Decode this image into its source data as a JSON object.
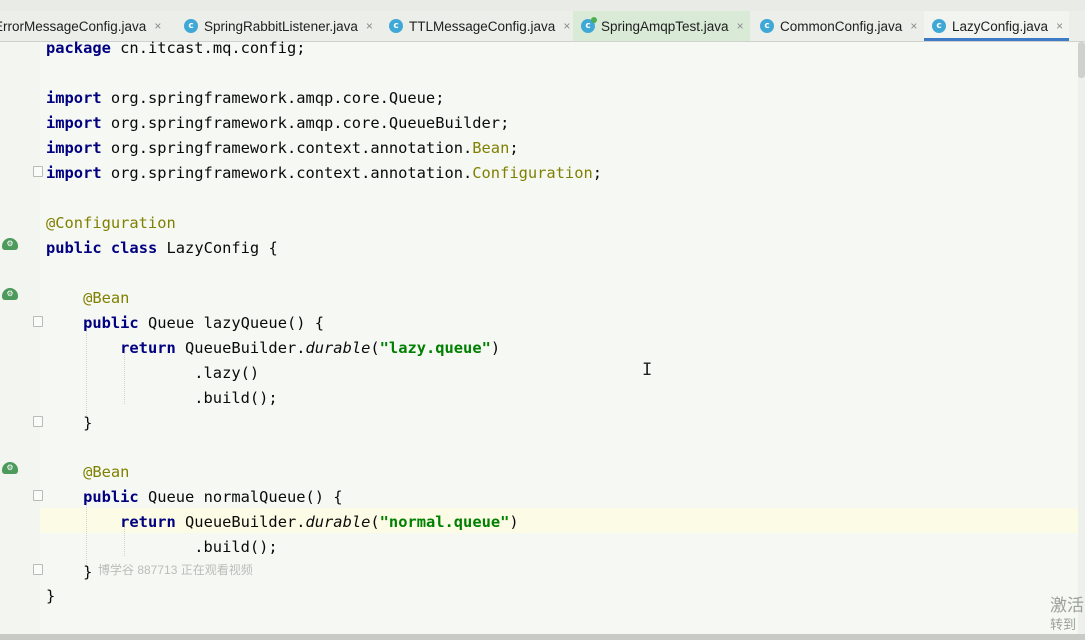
{
  "tabs": [
    {
      "name": "ErrorMessageConfig.java",
      "icon": "class-icon",
      "active": false
    },
    {
      "name": "SpringRabbitListener.java",
      "icon": "class-icon",
      "active": false
    },
    {
      "name": "TTLMessageConfig.java",
      "icon": "class-icon",
      "active": false
    },
    {
      "name": "SpringAmqpTest.java",
      "icon": "test-class-icon",
      "active": false
    },
    {
      "name": "CommonConfig.java",
      "icon": "class-icon",
      "active": false
    },
    {
      "name": "LazyConfig.java",
      "icon": "class-icon",
      "active": true
    }
  ],
  "tab_close_glyph": "×",
  "code": {
    "package_kw": "package",
    "package_name": "cn.itcast.mq.config;",
    "import_kw": "import",
    "imports": [
      {
        "path": "org.springframework.amqp.core.Queue",
        "ann": "",
        "end": ";"
      },
      {
        "path": "org.springframework.amqp.core.QueueBuilder",
        "ann": "",
        "end": ";"
      },
      {
        "path": "org.springframework.context.annotation.",
        "ann": "Bean",
        "end": ";"
      },
      {
        "path": "org.springframework.context.annotation.",
        "ann": "Configuration",
        "end": ";"
      }
    ],
    "class_annotation": "@Configuration",
    "public_kw": "public",
    "class_kw": "class",
    "class_name": "LazyConfig {",
    "bean_annotation": "@Bean",
    "return_kw": "return",
    "close_brace": "}",
    "methods": [
      {
        "signature": "Queue lazyQueue() {",
        "builder": "QueueBuilder.",
        "builder_method": "durable",
        "arg": "\"lazy.queue\"",
        "chain": [
          ".lazy()",
          ".build();"
        ]
      },
      {
        "signature": "Queue normalQueue() {",
        "builder": "QueueBuilder.",
        "builder_method": "durable",
        "arg": "\"normal.queue\"",
        "chain": [
          ".build();"
        ]
      }
    ],
    "paren_open": "(",
    "paren_close": ")"
  },
  "caret_glyph": "I",
  "overlay_text": "博学谷 887713 正在观看视频",
  "watermark": {
    "line1": "激活",
    "line2": "转到"
  },
  "colors": {
    "keyword": "#000080",
    "annotation": "#808000",
    "string": "#008000",
    "active_tab_underline": "#3e7bc6"
  }
}
